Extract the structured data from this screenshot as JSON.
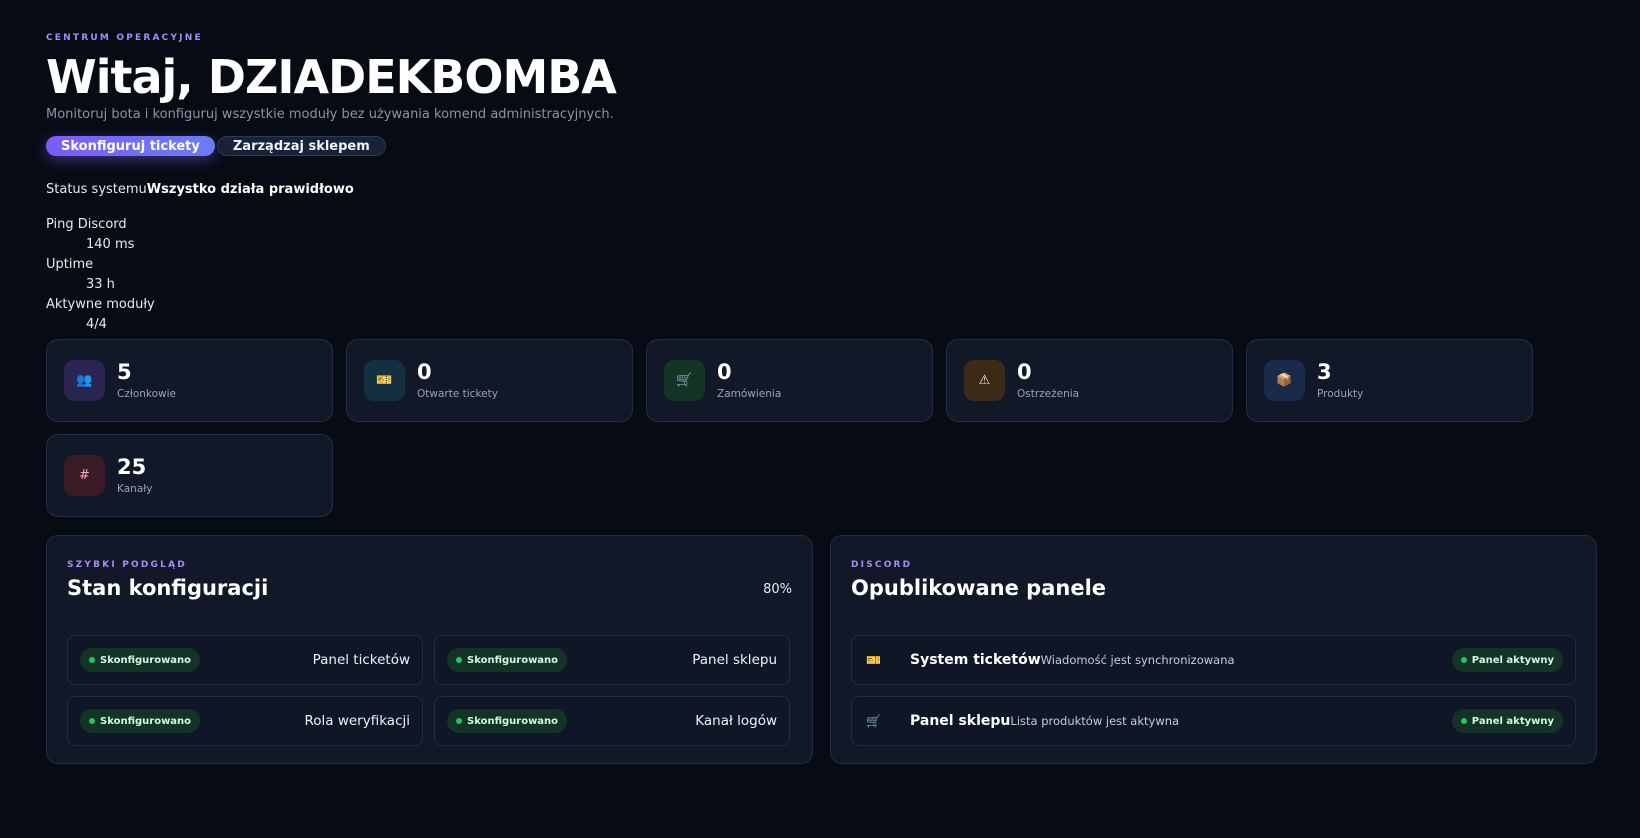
{
  "header": {
    "eyebrow": "CENTRUM OPERACYJNE",
    "title": "Witaj, DZIADEKBOMBA",
    "subtitle": "Monitoruj bota i konfiguruj wszystkie moduły bez używania komend administracyjnych.",
    "primary_button": "Skonfiguruj tickety",
    "secondary_button": "Zarządzaj sklepem"
  },
  "status": {
    "label": "Status systemu",
    "value": "Wszystko działa prawidłowo"
  },
  "metrics": [
    {
      "label": "Ping Discord",
      "value": "140 ms"
    },
    {
      "label": "Uptime",
      "value": "33 h"
    },
    {
      "label": "Aktywne moduły",
      "value": "4/4"
    }
  ],
  "stats": [
    {
      "value": "5",
      "label": "Członkowie",
      "icon": "members-icon",
      "glyph": "👥",
      "bg": "#2a2450"
    },
    {
      "value": "0",
      "label": "Otwarte tickety",
      "icon": "ticket-icon",
      "glyph": "🎫",
      "bg": "#123040"
    },
    {
      "value": "0",
      "label": "Zamówienia",
      "icon": "cart-icon",
      "glyph": "🛒",
      "bg": "#143526"
    },
    {
      "value": "0",
      "label": "Ostrzeżenia",
      "icon": "warning-icon",
      "glyph": "⚠",
      "bg": "#3b2a16"
    },
    {
      "value": "3",
      "label": "Produkty",
      "icon": "package-icon",
      "glyph": "📦",
      "bg": "#1a2a4a"
    },
    {
      "value": "25",
      "label": "Kanały",
      "icon": "hash-icon",
      "glyph": "#",
      "bg": "#3a1a24"
    }
  ],
  "config_panel": {
    "eyebrow": "SZYBKI PODGLĄD",
    "title": "Stan konfiguracji",
    "percent": "80%",
    "items": [
      {
        "badge": "Skonfigurowano",
        "name": "Panel ticketów"
      },
      {
        "badge": "Skonfigurowano",
        "name": "Panel sklepu"
      },
      {
        "badge": "Skonfigurowano",
        "name": "Rola weryfikacji"
      },
      {
        "badge": "Skonfigurowano",
        "name": "Kanał logów"
      }
    ]
  },
  "discord_panel": {
    "eyebrow": "DISCORD",
    "title": "Opublikowane panele",
    "rows": [
      {
        "icon": "ticket-icon",
        "glyph": "🎫",
        "title": "System ticketów",
        "desc": "Wiadomość jest synchronizowana",
        "badge": "Panel aktywny"
      },
      {
        "icon": "cart-icon",
        "glyph": "🛒",
        "title": "Panel sklepu",
        "desc": "Lista produktów jest aktywna",
        "badge": "Panel aktywny"
      }
    ]
  }
}
